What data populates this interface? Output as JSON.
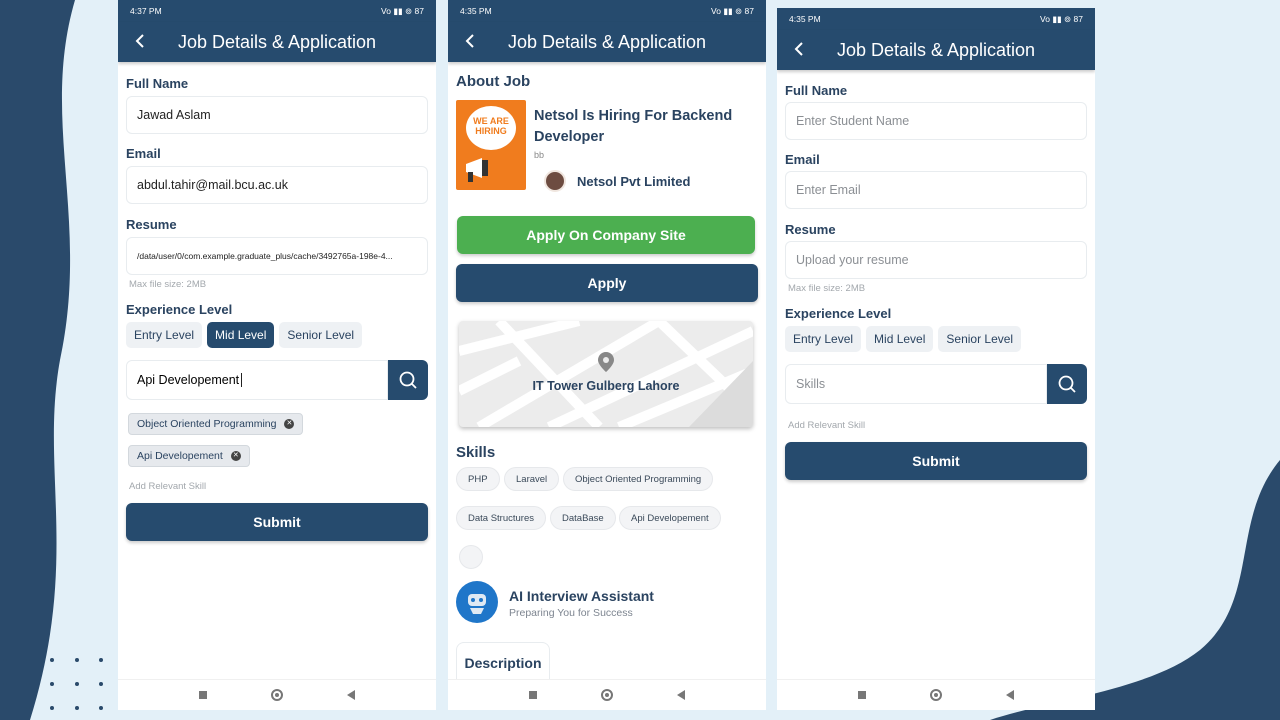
{
  "colors": {
    "primary": "#264b6e",
    "green": "#4caf50",
    "background": "#e3f0f8"
  },
  "screens": [
    {
      "status_time": "4:37 PM",
      "status_right": "Vo ▮▮ ⊚ 87",
      "title": "Job Details & Application",
      "full_name_label": "Full Name",
      "full_name_value": "Jawad Aslam",
      "email_label": "Email",
      "email_value": "abdul.tahir@mail.bcu.ac.uk",
      "resume_label": "Resume",
      "resume_value": "/data/user/0/com.example.graduate_plus/cache/3492765a-198e-4...",
      "resume_hint": "Max file size: 2MB",
      "experience_label": "Experience Level",
      "levels": [
        "Entry Level",
        "Mid Level",
        "Senior Level"
      ],
      "selected_level": "Mid Level",
      "skill_input_value": "Api Developement",
      "tags": [
        "Object Oriented Programming",
        "Api Developement"
      ],
      "add_skill_hint": "Add Relevant Skill",
      "submit_label": "Submit"
    },
    {
      "status_time": "4:35 PM",
      "status_right": "Vo ▮▮ ⊚ 87",
      "title": "Job Details & Application",
      "about_label": "About Job",
      "job_title": "Netsol Is Hiring For Backend Developer",
      "job_sub": "bb",
      "logo_text": "WE ARE HIRING",
      "company": "Netsol Pvt Limited",
      "apply_site_label": "Apply On Company Site",
      "apply_label": "Apply",
      "location": "IT Tower Gulberg Lahore",
      "skills_label": "Skills",
      "skills": [
        "PHP",
        "Laravel",
        "Object Oriented Programming",
        "Data Structures",
        "DataBase",
        "Api Developement"
      ],
      "assistant_title": "AI Interview Assistant",
      "assistant_sub": "Preparing You for Success",
      "description_tab": "Description"
    },
    {
      "status_time": "4:35 PM",
      "status_right": "Vo ▮▮ ⊚ 87",
      "title": "Job Details & Application",
      "full_name_label": "Full Name",
      "full_name_placeholder": "Enter Student Name",
      "email_label": "Email",
      "email_placeholder": "Enter Email",
      "resume_label": "Resume",
      "resume_placeholder": "Upload your resume",
      "resume_hint": "Max file size: 2MB",
      "experience_label": "Experience Level",
      "levels": [
        "Entry Level",
        "Mid Level",
        "Senior Level"
      ],
      "skills_placeholder": "Skills",
      "add_skill_hint": "Add Relevant Skill",
      "submit_label": "Submit"
    }
  ]
}
